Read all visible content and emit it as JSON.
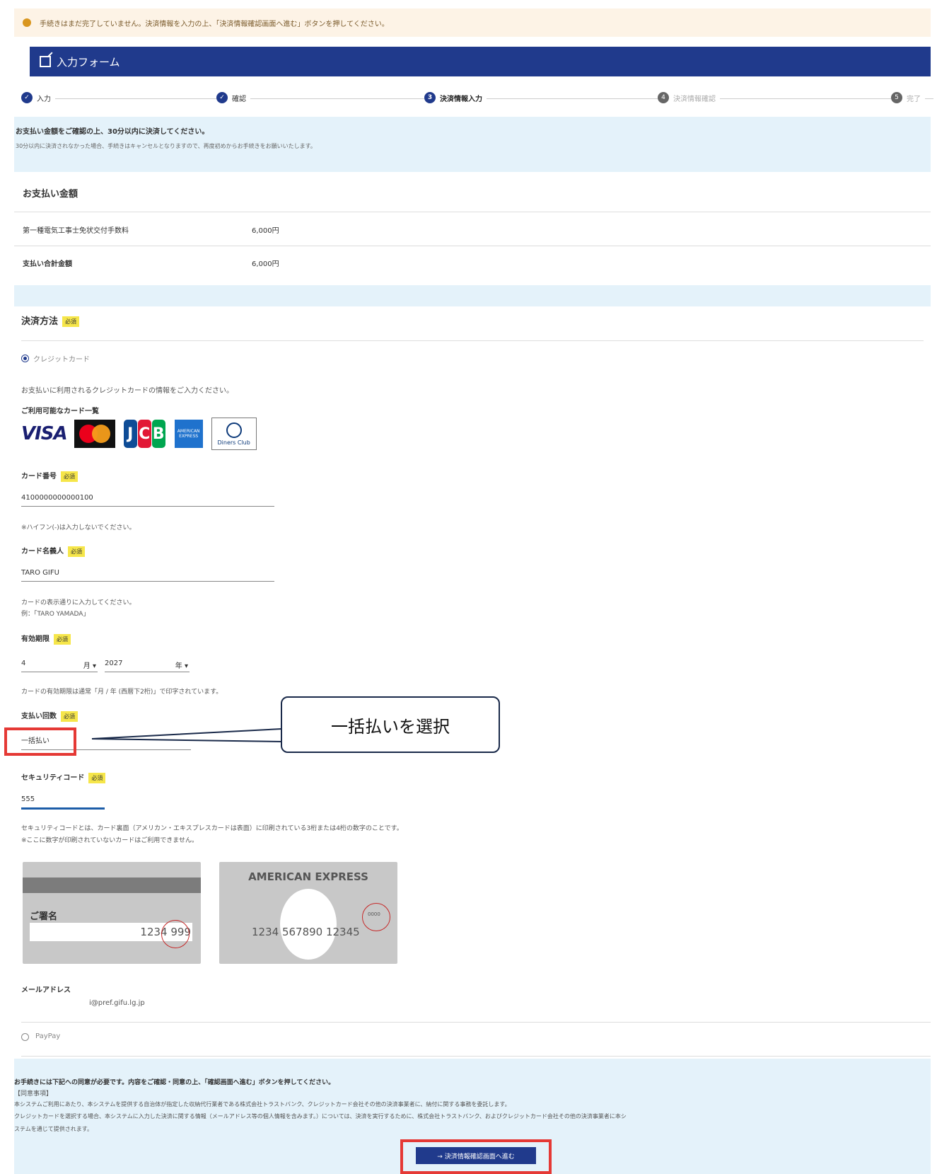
{
  "alert": {
    "text": "手続きはまだ完了していません。決済情報を入力の上、「決済情報確認画面へ進む」ボタンを押してください。"
  },
  "header": {
    "title": "入力フォーム"
  },
  "steps": [
    {
      "label": "入力",
      "number": "✓"
    },
    {
      "label": "確認",
      "number": "✓"
    },
    {
      "label": "決済情報入力",
      "number": "3"
    },
    {
      "label": "決済情報確認",
      "number": "4"
    },
    {
      "label": "完了",
      "number": "5"
    }
  ],
  "info": {
    "line1": "お支払い金額をご確認の上、30分以内に決済してください。",
    "line2": "30分以内に決済されなかった場合、手続きはキャンセルとなりますので、再度初めからお手続きをお願いいたします。"
  },
  "payment": {
    "title": "お支払い金額",
    "rows": [
      {
        "label": "第一種電気工事士免状交付手数料",
        "value": "6,000円"
      },
      {
        "label": "支払い合計金額",
        "value": "6,000円"
      }
    ]
  },
  "method": {
    "title": "決済方法",
    "required": "必須",
    "credit_label": "クレジットカード",
    "credit_note": "お支払いに利用されるクレジットカードの情報をご入力ください。",
    "cards_label": "ご利用可能なカード一覧",
    "logos": {
      "visa": "VISA",
      "jcb": [
        "J",
        "C",
        "B"
      ],
      "amex": "AMERICAN EXPRESS",
      "diners": "Diners Club"
    },
    "card_number_label": "カード番号",
    "card_number_value": "4100000000000100",
    "card_number_note": "※ハイフン(-)は入力しないでください。",
    "holder_label": "カード名義人",
    "holder_value": "TARO GIFU",
    "holder_note1": "カードの表示通りに入力してください。",
    "holder_note2": "例：「TARO YAMADA」",
    "expiry_label": "有効期限",
    "expiry_month": "4",
    "expiry_month_unit": "月 ▾",
    "expiry_year": "2027",
    "expiry_year_unit": "年 ▾",
    "expiry_note": "カードの有効期限は通常「月 / 年 (西暦下2桁)」で印字されています。",
    "installment_label": "支払い回数",
    "installment_value": "一括払い",
    "security_label": "セキュリティコード",
    "security_value": "555",
    "security_note1": "セキュリティコードとは、カード裏面（アメリカン・エキスプレスカードは表面）に印刷されている3桁または4桁の数字のことです。",
    "security_note2": "※ここに数字が印刷されていないカードはご利用できません。",
    "sample_back": {
      "signature": "ご署名",
      "number": "1234 999"
    },
    "sample_amex": {
      "brand": "AMERICAN EXPRESS",
      "number": "1234 567890 12345",
      "cvv": "0000"
    },
    "email_label": "メールアドレス",
    "email_value": "i@pref.gifu.lg.jp",
    "paypay_label": "PayPay"
  },
  "callout": {
    "text": "一括払いを選択"
  },
  "consent": {
    "line1": "お手続きには下記への同意が必要です。内容をご確認・同意の上、「確認画面へ進む」ボタンを押してください。",
    "line2": "【同意事項】",
    "line3": "本システムご利用にあたり、本システムを提供する自治体が指定した収納代行業者である株式会社トラストバンク、クレジットカード会社その他の決済事業者に、納付に関する事務を委託します。",
    "line4": "クレジットカードを選択する場合、本システムに入力した決済に関する情報（メールアドレス等の個人情報を含みます。）については、決済を実行するために、株式会社トラストバンク、およびクレジットカード会社その他の決済事業者に本シ",
    "line5": "ステムを通じて提供されます。"
  },
  "submit": {
    "label": "→ 決済情報確認画面へ進む"
  }
}
